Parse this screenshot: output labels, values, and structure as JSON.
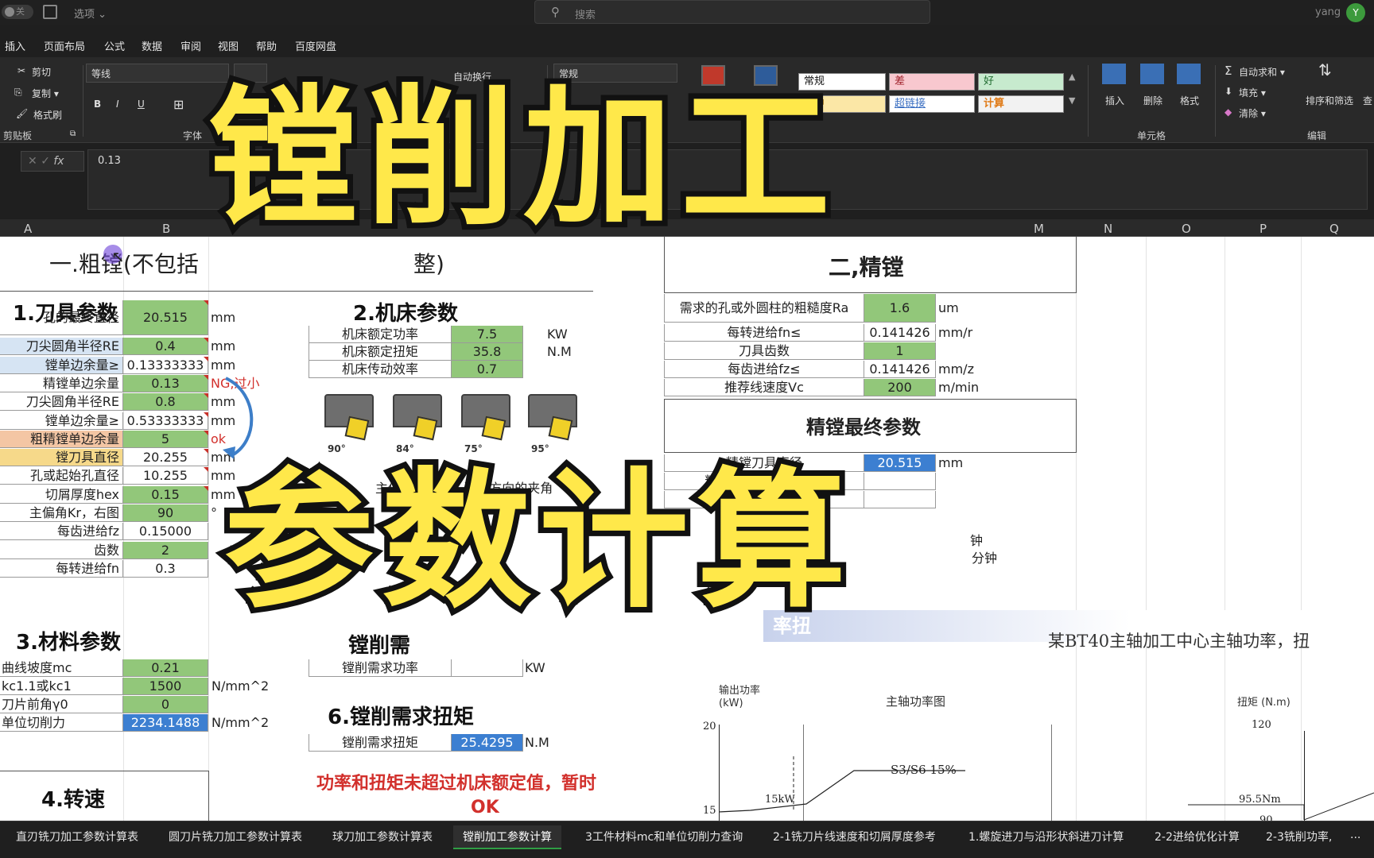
{
  "titlebar": {
    "autosave": "关",
    "options": "选项 ⌄",
    "search_placeholder": "搜索",
    "user": "yang",
    "avatar_initial": "Y"
  },
  "menu": [
    "插入",
    "页面布局",
    "公式",
    "数据",
    "审阅",
    "视图",
    "帮助",
    "百度网盘"
  ],
  "ribbon": {
    "cut": "剪切",
    "copy": "复制 ▾",
    "format_painter": "格式刷",
    "clipboard_group": "剪贴板",
    "font_name": "等线",
    "font_group": "字体",
    "wrap": "自动换行",
    "number_format": "常规",
    "cond_format": "条件格式",
    "table_format": "套用",
    "styles": {
      "normal": "常规",
      "bad": "差",
      "good": "好",
      "neutral": "适中",
      "hyperlink": "超链接",
      "calc": "计算"
    },
    "insert": "插入",
    "delete": "删除",
    "format": "格式",
    "cells_group": "单元格",
    "autosum": "自动求和 ▾",
    "fill": "填充 ▾",
    "clear": "清除 ▾",
    "sort_filter": "排序和筛选",
    "find": "查",
    "editing_group": "编辑"
  },
  "formula_bar": {
    "value": "0.13"
  },
  "columns": [
    "A",
    "B",
    "M",
    "N",
    "O",
    "P",
    "Q"
  ],
  "sheet": {
    "rough_title": "一.粗镗(不包括",
    "rough_title_tail": "整)",
    "finish_title": "二,精镗",
    "tool_params": "1.刀具参数",
    "machine_params": "2.机床参数",
    "material_params": "3.材料参数",
    "speed": "4.转速",
    "power_req": "镗削需",
    "torque_req": "6.镗削需求扭矩",
    "left_rows": [
      {
        "label": "孔的最终直径",
        "value": "20.515",
        "unit": "mm"
      },
      {
        "label": "刀尖圆角半径RE",
        "value": "0.4",
        "unit": "mm"
      },
      {
        "label": "镗单边余量≥",
        "value": "0.13333333",
        "unit": "mm"
      },
      {
        "label": "精镗单边余量",
        "value": "0.13",
        "unit": "NG,过小"
      },
      {
        "label": "刀尖圆角半径RE",
        "value": "0.8",
        "unit": "mm"
      },
      {
        "label": "镗单边余量≥",
        "value": "0.53333333",
        "unit": "mm"
      },
      {
        "label": "粗精镗单边余量",
        "value": "5",
        "unit": "ok"
      },
      {
        "label": "镗刀具直径",
        "value": "20.255",
        "unit": "mm"
      },
      {
        "label": "孔或起始孔直径",
        "value": "10.255",
        "unit": "mm"
      },
      {
        "label": "切屑厚度hex",
        "value": "0.15",
        "unit": "mm"
      },
      {
        "label": "主偏角Kr，右图",
        "value": "90",
        "unit": "°"
      },
      {
        "label": "每齿进给fz",
        "value": "0.15000",
        "unit": ""
      },
      {
        "label": "齿数",
        "value": "2",
        "unit": ""
      },
      {
        "label": "每转进给fn",
        "value": "0.3",
        "unit": ""
      }
    ],
    "material_rows": [
      {
        "label": "曲线坡度mc",
        "value": "0.21",
        "unit": ""
      },
      {
        "label": "kc1.1或kc1",
        "value": "1500",
        "unit": "N/mm^2"
      },
      {
        "label": "刀片前角γ0",
        "value": "0",
        "unit": ""
      },
      {
        "label": "单位切削力",
        "value": "2234.1488",
        "unit": "N/mm^2"
      }
    ],
    "machine_rows": [
      {
        "label": "机床额定功率",
        "value": "7.5",
        "unit": "KW"
      },
      {
        "label": "机床额定扭矩",
        "value": "35.8",
        "unit": "N.M"
      },
      {
        "label": "机床传动效率",
        "value": "0.7",
        "unit": ""
      }
    ],
    "tool_angles": [
      "90°",
      "84°",
      "75°",
      "95°"
    ],
    "tool_caption": "主偏角：主轴...进给方向的夹角",
    "power_req_label": "镗削需求功率",
    "power_req_unit": "KW",
    "torque_label": "镗削需求扭矩",
    "torque_value": "25.4295",
    "torque_unit": "N.M",
    "warning_line1": "功率和扭矩未超过机床额定值，暂时",
    "warning_line2": "OK",
    "finish_rows": [
      {
        "label": "需求的孔或外圆柱的粗糙度Ra",
        "value": "1.6",
        "unit": "um"
      },
      {
        "label": "每转进给fn≤",
        "value": "0.141426",
        "unit": "mm/r"
      },
      {
        "label": "刀具齿数",
        "value": "1",
        "unit": ""
      },
      {
        "label": "每齿进给fz≤",
        "value": "0.141426",
        "unit": "mm/z"
      },
      {
        "label": "推荐线速度Vc",
        "value": "200",
        "unit": "m/min"
      }
    ],
    "finish_final_title": "精镗最终参数",
    "finish_final_rows": [
      {
        "label": "精镗刀具直径",
        "value": "20.515",
        "unit": "mm"
      },
      {
        "label": "精镗刀尖圆角半径RE",
        "value": "",
        "unit": ""
      },
      {
        "label": "单边余量",
        "value": "",
        "unit": ""
      }
    ],
    "finish_partial": [
      "钟",
      "分钟",
      "角推荐≥"
    ],
    "spindle_band": "率扭",
    "spindle_desc": "某BT40主轴加工中心主轴功率，扭",
    "chart": {
      "power_label": "输出功率\n(kW)",
      "title": "主轴功率图",
      "torque_label": "扭矩 (N.m)",
      "y20": "20",
      "y15": "15",
      "s3": "S3/S6 15%",
      "kw15": "15kW",
      "t120": "120",
      "t95": "95.5Nm",
      "t90": "90"
    }
  },
  "sheet_tabs": [
    "直刃铣刀加工参数计算表",
    "圆刀片铣刀加工参数计算表",
    "球刀加工参数计算表",
    "镗削加工参数计算",
    "3工件材料mc和单位切削力查询",
    "2-1铣刀片线速度和切屑厚度参考",
    "1.螺旋进刀与沿形状斜进刀计算",
    "2-2进给优化计算",
    "2-3铣削功率,",
    "..."
  ],
  "overlay": {
    "line1": "镗削加工",
    "line2": "参数计算"
  }
}
